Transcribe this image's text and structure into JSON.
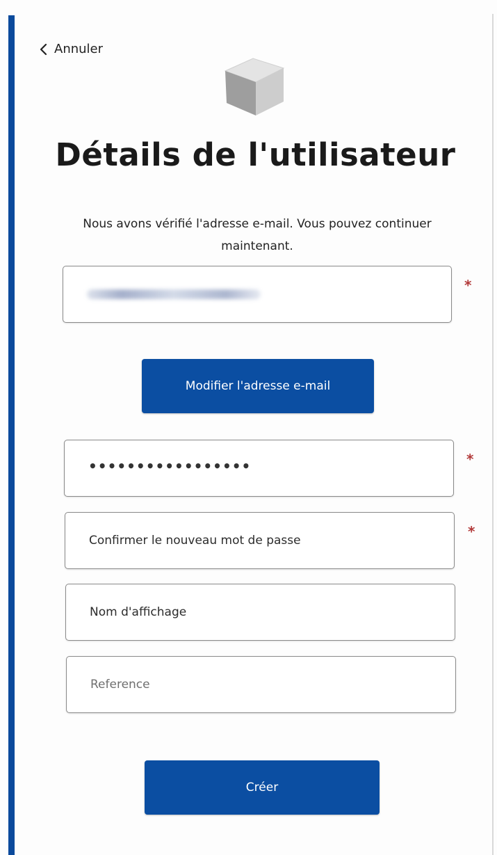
{
  "header": {
    "back_label": "Annuler",
    "title": "Détails de l'utilisateur",
    "intro": "Nous avons vérifié l'adresse e-mail. Vous pouvez continuer maintenant."
  },
  "form": {
    "email": {
      "value_hidden": true,
      "required_marker": "*"
    },
    "change_email_button": "Modifier l'adresse e-mail",
    "password": {
      "value": "•••••••••••••••••",
      "required_marker": "*"
    },
    "confirm_password": {
      "placeholder": "Confirmer le nouveau mot de passe",
      "required_marker": "*"
    },
    "display_name": {
      "placeholder": "Nom d'affichage"
    },
    "reference": {
      "placeholder": "Reference"
    },
    "submit_button": "Créer"
  },
  "icons": {
    "back": "chevron-left-icon",
    "logo": "cube-icon"
  },
  "colors": {
    "accent": "#0b4ea2",
    "side_bar": "#0b4a9c",
    "required": "#b23a3a"
  }
}
